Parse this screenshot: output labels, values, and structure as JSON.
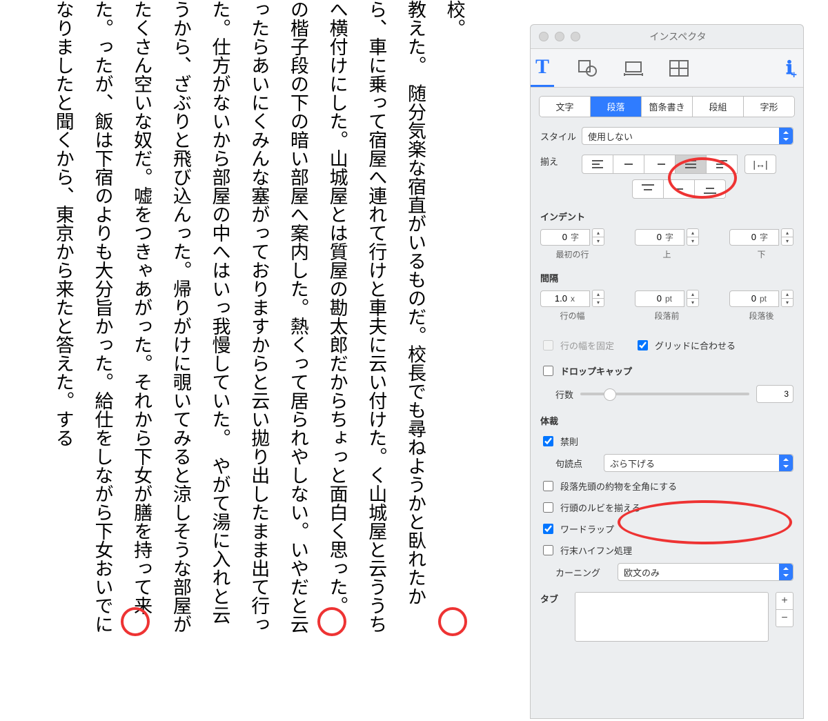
{
  "doc": {
    "text": "校。\n教えた。　随分気楽な宿直がいるものだ。校長でも尋ねようかと臥れたから、車に乗って宿屋へ連れて行けと車夫に云い付けた。く山城屋と云ううちへ横付けにした。山城屋とは質屋の勘太郎だからちょっと面白く思った。\nの楷子段の下の暗い部屋へ案内した。熱くって居られやしない。いやだと云ったらあいにくみんな塞がっておりますからと云い拋り出したまま出て行った。仕方がないから部屋の中へはいっ我慢していた。　やがて湯に入れと云うから、ざぶりと飛び込んった。帰りがけに覗いてみると涼しそうな部屋がたくさん空いな奴だ。嘘をつきゃあがった。それから下女が膳を持って来た。ったが、飯は下宿のよりも大分旨かった。給仕をしながら下女おいでになりましたと聞くから、東京から来たと答えた。する"
  },
  "inspector": {
    "title": "インスペクタ",
    "tabs": [
      "文字",
      "段落",
      "箇条書き",
      "段組",
      "字形"
    ],
    "style": {
      "label": "スタイル",
      "value": "使用しない"
    },
    "align": {
      "label": "揃え"
    },
    "indent": {
      "label": "インデント",
      "first": {
        "value": "0",
        "unit": "字",
        "caption": "最初の行"
      },
      "top": {
        "value": "0",
        "unit": "字",
        "caption": "上"
      },
      "bottom": {
        "value": "0",
        "unit": "字",
        "caption": "下"
      }
    },
    "spacing": {
      "label": "間隔",
      "line": {
        "value": "1.0",
        "unit": "x",
        "caption": "行の幅"
      },
      "before": {
        "value": "0",
        "unit": "pt",
        "caption": "段落前"
      },
      "after": {
        "value": "0",
        "unit": "pt",
        "caption": "段落後"
      },
      "fixed": "行の幅を固定",
      "grid": "グリッドに合わせる"
    },
    "dropcap": {
      "label": "ドロップキャップ",
      "lines_label": "行数",
      "lines_value": "3"
    },
    "format": {
      "label": "体裁",
      "kinsoku": "禁則",
      "punct": {
        "label": "句読点",
        "value": "ぶら下げる"
      },
      "fullwidth": "段落先頭の約物を全角にする",
      "ruby": "行頭のルビを揃える",
      "wrap": "ワードラップ",
      "hyphen": "行末ハイフン処理",
      "kerning": {
        "label": "カーニング",
        "value": "欧文のみ"
      }
    },
    "tab": {
      "label": "タブ"
    }
  }
}
